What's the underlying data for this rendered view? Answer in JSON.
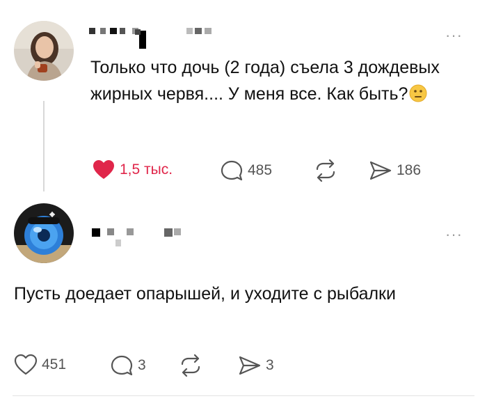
{
  "post1": {
    "text": "Только что дочь (2 года) съела 3 дождевых жирных червя.... У меня все. Как быть?",
    "emoji": "neutral-face-emoji",
    "likes": "1,5 тыс.",
    "replies": "485",
    "shares": "186",
    "liked": true
  },
  "post2": {
    "text": "Пусть доедает опарышей, и уходите с рыбалки",
    "likes": "451",
    "replies": "3",
    "shares": "3",
    "liked": false
  },
  "colors": {
    "like_active": "#e0264a",
    "icon_gray": "#555555",
    "emoji_yellow": "#f7c744"
  },
  "icons": [
    "heart-icon",
    "comment-icon",
    "repost-icon",
    "send-icon",
    "more-icon"
  ]
}
